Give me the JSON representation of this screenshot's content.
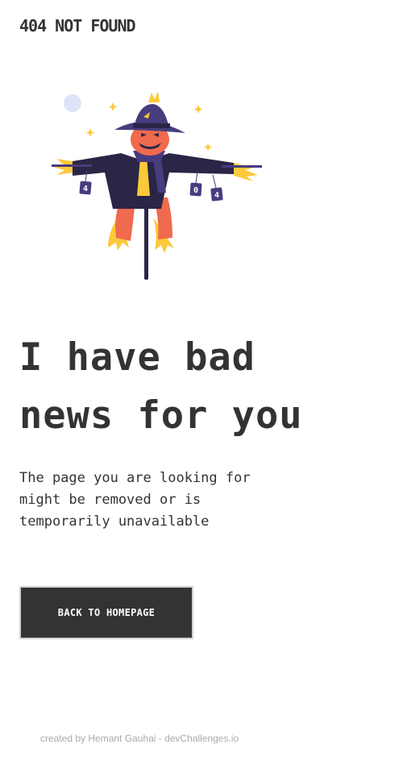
{
  "header": {
    "brand": "404 NOT FOUND"
  },
  "illustration": {
    "icon": "scarecrow-illustration",
    "tag_left": "4",
    "tag_right_1": "0",
    "tag_right_2": "4",
    "colors": {
      "hat": "#473c7e",
      "coat": "#2b2546",
      "pumpkin": "#f06a4e",
      "straw": "#fcc93a",
      "moon": "#dde4f7"
    }
  },
  "main": {
    "headline_line1": "I have bad",
    "headline_line2": "news for you",
    "subtext_line1": "The page you are looking for",
    "subtext_line2": "might be removed or is",
    "subtext_line3": "temporarily unavailable",
    "cta_label": "BACK TO HOMEPAGE"
  },
  "footer": {
    "credit": "created by Hemant Gauhai - devChallenges.io"
  }
}
